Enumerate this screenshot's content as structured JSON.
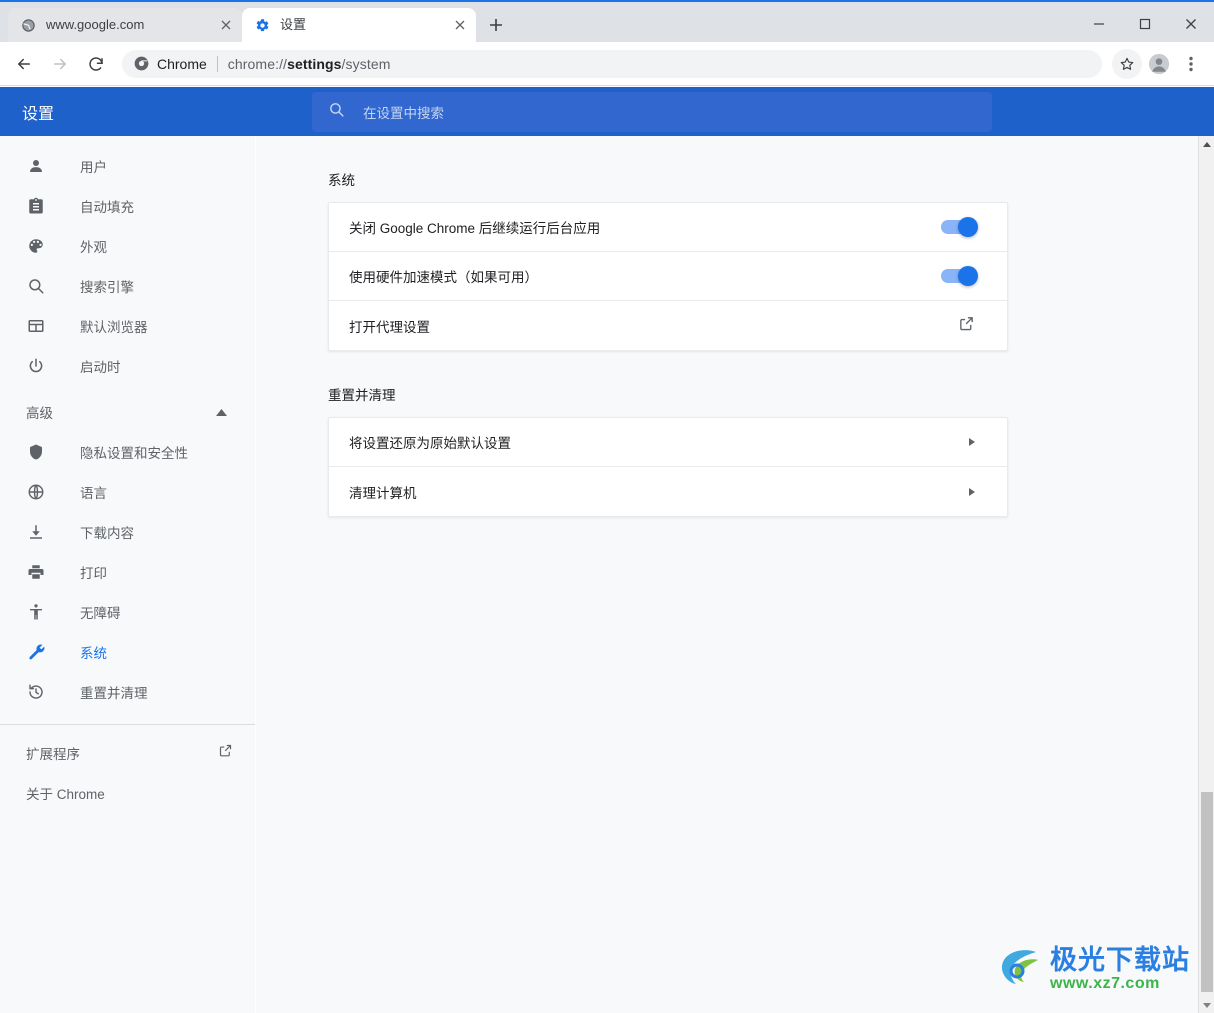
{
  "window": {
    "controls": [
      {
        "name": "minimize",
        "glyph": "—"
      },
      {
        "name": "maximize",
        "glyph": "☐"
      },
      {
        "name": "close",
        "glyph": "✕"
      }
    ]
  },
  "tabs": [
    {
      "title": "www.google.com",
      "favicon": "globe-icon",
      "active": false,
      "close_label": "×"
    },
    {
      "title": "设置",
      "favicon": "gear-icon",
      "active": true,
      "close_label": "×"
    }
  ],
  "new_tab_label": "+",
  "toolbar": {
    "back_label": "←",
    "forward_label": "→",
    "reload_label": "⟳",
    "chrome_label": "Chrome",
    "url_prefix": "chrome://",
    "url_bold": "settings",
    "url_suffix": "/system",
    "url_full": "chrome://settings/system",
    "bookmark_icon": "star-icon",
    "profile_icon": "avatar-icon",
    "menu_icon": "three-dot-menu-icon"
  },
  "settings_header": {
    "title": "设置",
    "search_placeholder": "在设置中搜索",
    "search_value": "",
    "bg_color": "#1f61cb",
    "search_bg_color": "#3167cf"
  },
  "sidebar": {
    "items": [
      {
        "label": "用户",
        "icon": "person-icon",
        "selected": false
      },
      {
        "label": "自动填充",
        "icon": "clipboard-icon",
        "selected": false
      },
      {
        "label": "外观",
        "icon": "palette-icon",
        "selected": false
      },
      {
        "label": "搜索引擎",
        "icon": "search-icon",
        "selected": false
      },
      {
        "label": "默认浏览器",
        "icon": "browser-window-icon",
        "selected": false
      },
      {
        "label": "启动时",
        "icon": "power-icon",
        "selected": false
      }
    ],
    "advanced": {
      "label": "高级",
      "expanded": true,
      "caret_icon": "chevron-up-icon"
    },
    "advanced_items": [
      {
        "label": "隐私设置和安全性",
        "icon": "shield-icon",
        "selected": false
      },
      {
        "label": "语言",
        "icon": "globe-icon",
        "selected": false
      },
      {
        "label": "下载内容",
        "icon": "download-icon",
        "selected": false
      },
      {
        "label": "打印",
        "icon": "printer-icon",
        "selected": false
      },
      {
        "label": "无障碍",
        "icon": "accessibility-icon",
        "selected": false
      },
      {
        "label": "系统",
        "icon": "wrench-icon",
        "selected": true
      },
      {
        "label": "重置并清理",
        "icon": "history-icon",
        "selected": false
      }
    ],
    "footer": [
      {
        "label": "扩展程序",
        "external": true,
        "icon": "external-link-icon"
      },
      {
        "label": "关于 Chrome",
        "external": false
      }
    ],
    "selected_color": "#1a73e8"
  },
  "main": {
    "sections": [
      {
        "title": "系统",
        "rows": [
          {
            "label": "关闭 Google Chrome 后继续运行后台应用",
            "control": "toggle",
            "toggle_on": true
          },
          {
            "label": "使用硬件加速模式（如果可用）",
            "control": "toggle",
            "toggle_on": true
          },
          {
            "label": "打开代理设置",
            "control": "external-link-icon",
            "toggle_on": false
          }
        ]
      },
      {
        "title": "重置并清理",
        "rows": [
          {
            "label": "将设置还原为原始默认设置",
            "control": "arrow-right-icon",
            "toggle_on": false
          },
          {
            "label": "清理计算机",
            "control": "arrow-right-icon",
            "toggle_on": false
          }
        ]
      }
    ]
  },
  "scrollbar": {
    "up_icon": "scroll-up-arrow",
    "down_icon": "scroll-down-arrow"
  },
  "watermark": {
    "main": "极光下载站",
    "sub": "www.xz7.com",
    "main_color": "#2b7fe0",
    "sub_color": "#3cb44b"
  }
}
